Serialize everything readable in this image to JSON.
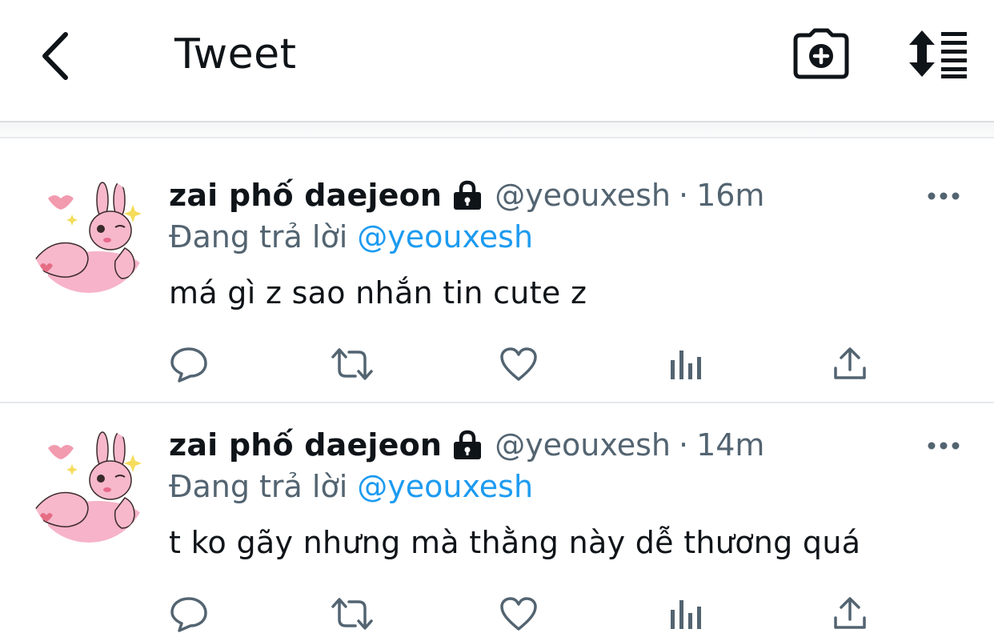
{
  "header": {
    "title": "Tweet",
    "icons": {
      "back": "chevron-left-icon",
      "camera": "camera-plus-icon",
      "sort": "sort-lines-icon"
    }
  },
  "colors": {
    "link": "#1d9bf0",
    "muted": "#536471",
    "text": "#0f1419",
    "icon": "#536471"
  },
  "tweets": [
    {
      "display_name": "zai phố daejeon",
      "handle": "@yeouxesh",
      "separator": "·",
      "time": "16m",
      "reply_prefix": "Đang trả lời",
      "reply_to": "@yeouxesh",
      "text": "má gì z sao nhắn tin cute z"
    },
    {
      "display_name": "zai phố daejeon",
      "handle": "@yeouxesh",
      "separator": "·",
      "time": "14m",
      "reply_prefix": "Đang trả lời",
      "reply_to": "@yeouxesh",
      "text": "t ko gãy nhưng mà thằng này dễ thương quá"
    }
  ]
}
